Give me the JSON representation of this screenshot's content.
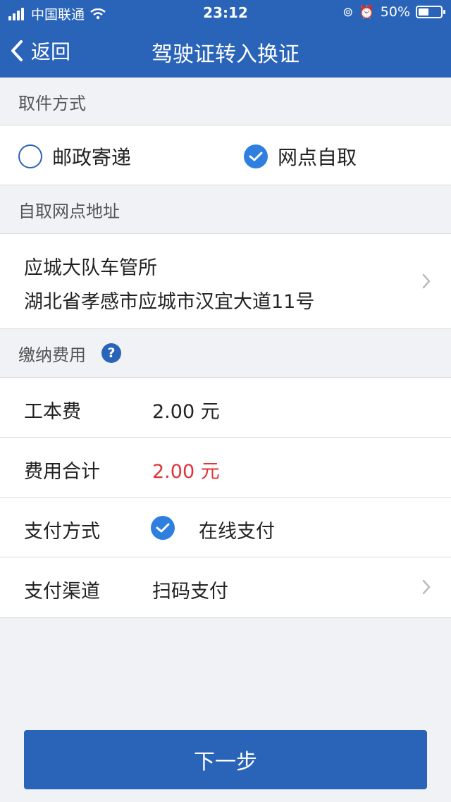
{
  "status_bar": {
    "carrier": "中国联通",
    "time": "23:12",
    "battery": "50%",
    "battery_level": 0.5
  },
  "nav": {
    "back_label": "返回",
    "title": "驾驶证转入换证"
  },
  "pickup": {
    "header": "取件方式",
    "options": [
      {
        "label": "邮政寄递",
        "selected": false
      },
      {
        "label": "网点自取",
        "selected": true
      }
    ]
  },
  "address": {
    "header": "自取网点地址",
    "name": "应城大队车管所",
    "detail": "湖北省孝感市应城市汉宜大道11号"
  },
  "fees": {
    "header": "缴纳费用",
    "help_glyph": "?",
    "rows": [
      {
        "label": "工本费",
        "value": "2.00 元"
      },
      {
        "label": "费用合计",
        "value": "2.00 元"
      },
      {
        "label": "支付方式",
        "value": "在线支付"
      },
      {
        "label": "支付渠道",
        "value": "扫码支付"
      }
    ]
  },
  "next_button": "下一步",
  "colors": {
    "primary": "#2a64b8",
    "check": "#2f7fe0",
    "total": "#e0343a"
  }
}
